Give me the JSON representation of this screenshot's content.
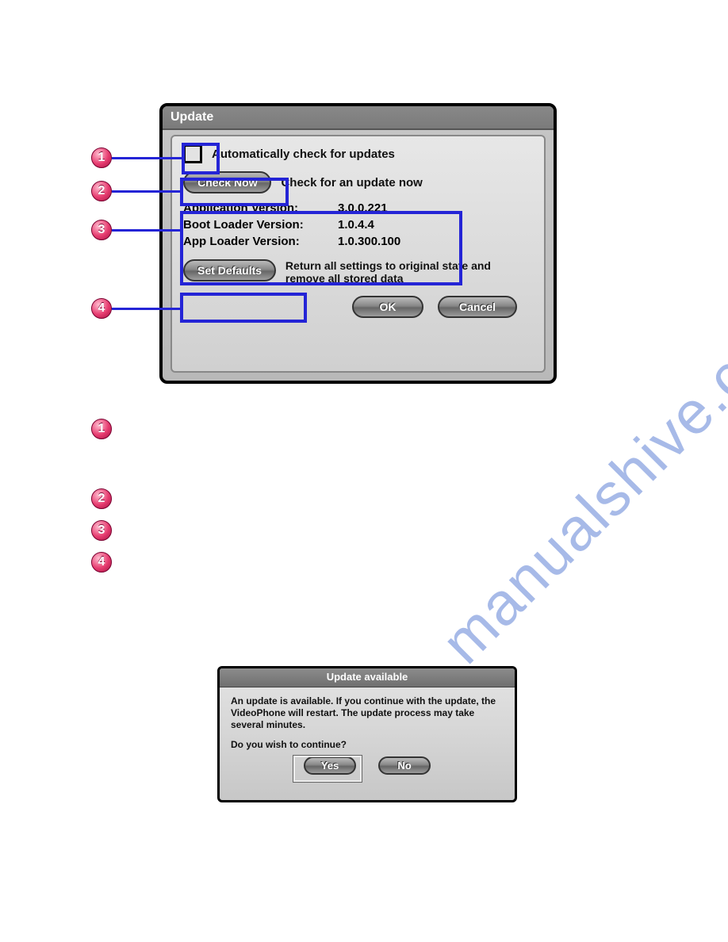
{
  "watermark": "manualshive.com",
  "update_dialog": {
    "title": "Update",
    "auto_check_label": "Automatically check for updates",
    "check_now_button": "Check Now",
    "check_now_label": "Check for an update now",
    "version_fields": {
      "application": {
        "label": "Application Version:",
        "value": "3.0.0.221"
      },
      "boot_loader": {
        "label": "Boot Loader Version:",
        "value": "1.0.4.4"
      },
      "app_loader": {
        "label": "App Loader Version:",
        "value": "1.0.300.100"
      }
    },
    "set_defaults_button": "Set Defaults",
    "set_defaults_label": "Return all settings to original state and remove all stored data",
    "ok_button": "OK",
    "cancel_button": "Cancel"
  },
  "callouts": {
    "c1": "1",
    "c2": "2",
    "c3": "3",
    "c4": "4"
  },
  "list_markers": {
    "m1": "1",
    "m2": "2",
    "m3": "3",
    "m4": "4"
  },
  "available_dialog": {
    "title": "Update available",
    "line1": "An update is available.  If you continue with the update, the VideoPhone will restart.  The update process may take several minutes.",
    "line2": "Do you wish to continue?",
    "yes_button": "Yes",
    "no_button": "No"
  }
}
